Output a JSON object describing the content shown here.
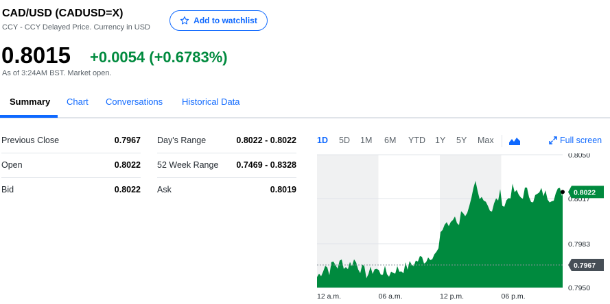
{
  "header": {
    "title": "CAD/USD (CADUSD=X)",
    "subtitle": "CCY - CCY Delayed Price. Currency in USD",
    "watchlist_label": "Add to watchlist"
  },
  "quote": {
    "price": "0.8015",
    "change": "+0.0054 (+0.6783%)",
    "as_of": "As of 3:24AM BST. Market open."
  },
  "tabs": [
    {
      "label": "Summary",
      "active": true
    },
    {
      "label": "Chart",
      "active": false
    },
    {
      "label": "Conversations",
      "active": false
    },
    {
      "label": "Historical Data",
      "active": false
    }
  ],
  "stats": {
    "left": [
      {
        "label": "Previous Close",
        "value": "0.7967"
      },
      {
        "label": "Open",
        "value": "0.8022"
      },
      {
        "label": "Bid",
        "value": "0.8022"
      }
    ],
    "right": [
      {
        "label": "Day's Range",
        "value": "0.8022 - 0.8022"
      },
      {
        "label": "52 Week Range",
        "value": "0.7469 - 0.8328"
      },
      {
        "label": "Ask",
        "value": "0.8019"
      }
    ]
  },
  "chart_controls": {
    "ranges": [
      "1D",
      "5D",
      "1M",
      "6M",
      "YTD",
      "1Y",
      "5Y",
      "Max"
    ],
    "active_range": "1D",
    "fullscreen_label": "Full screen",
    "chart_type_icon": "mountain-chart-icon"
  },
  "colors": {
    "accent": "#0f69ff",
    "positive": "#008a3e",
    "area_fill": "#008a3e",
    "prev_close_tag": "#464e56"
  },
  "chart_data": {
    "type": "area",
    "x_ticks": [
      "12 a.m.",
      "06 a.m.",
      "12 p.m.",
      "06 p.m."
    ],
    "y_ticks": [
      "0.8050",
      "0.8017",
      "0.7983",
      "0.7950"
    ],
    "ylim": [
      0.795,
      0.805
    ],
    "current_price_tag": "0.8022",
    "prev_close_tag": "0.7967",
    "prev_close_value": 0.7967,
    "current_value": 0.8022,
    "series": [
      {
        "values": [
          0.7958,
          0.7962,
          0.7967,
          0.7963,
          0.7969,
          0.7966,
          0.797,
          0.7965,
          0.7968,
          0.7971,
          0.7966,
          0.7963,
          0.796,
          0.7962,
          0.7965,
          0.7961,
          0.7963,
          0.796,
          0.7962,
          0.7964,
          0.7963,
          0.7965,
          0.7966,
          0.7968,
          0.797,
          0.7972,
          0.7971,
          0.7974,
          0.7976,
          0.7975,
          0.7994,
          0.8,
          0.7995,
          0.8005,
          0.7998,
          0.801,
          0.8003,
          0.8012,
          0.8028,
          0.8015,
          0.802,
          0.8013,
          0.8008,
          0.8015,
          0.802,
          0.8012,
          0.8018,
          0.8024,
          0.802,
          0.8018,
          0.8023,
          0.802,
          0.8017,
          0.8019,
          0.8022,
          0.802,
          0.8018,
          0.802,
          0.8022,
          0.8022
        ]
      }
    ]
  }
}
